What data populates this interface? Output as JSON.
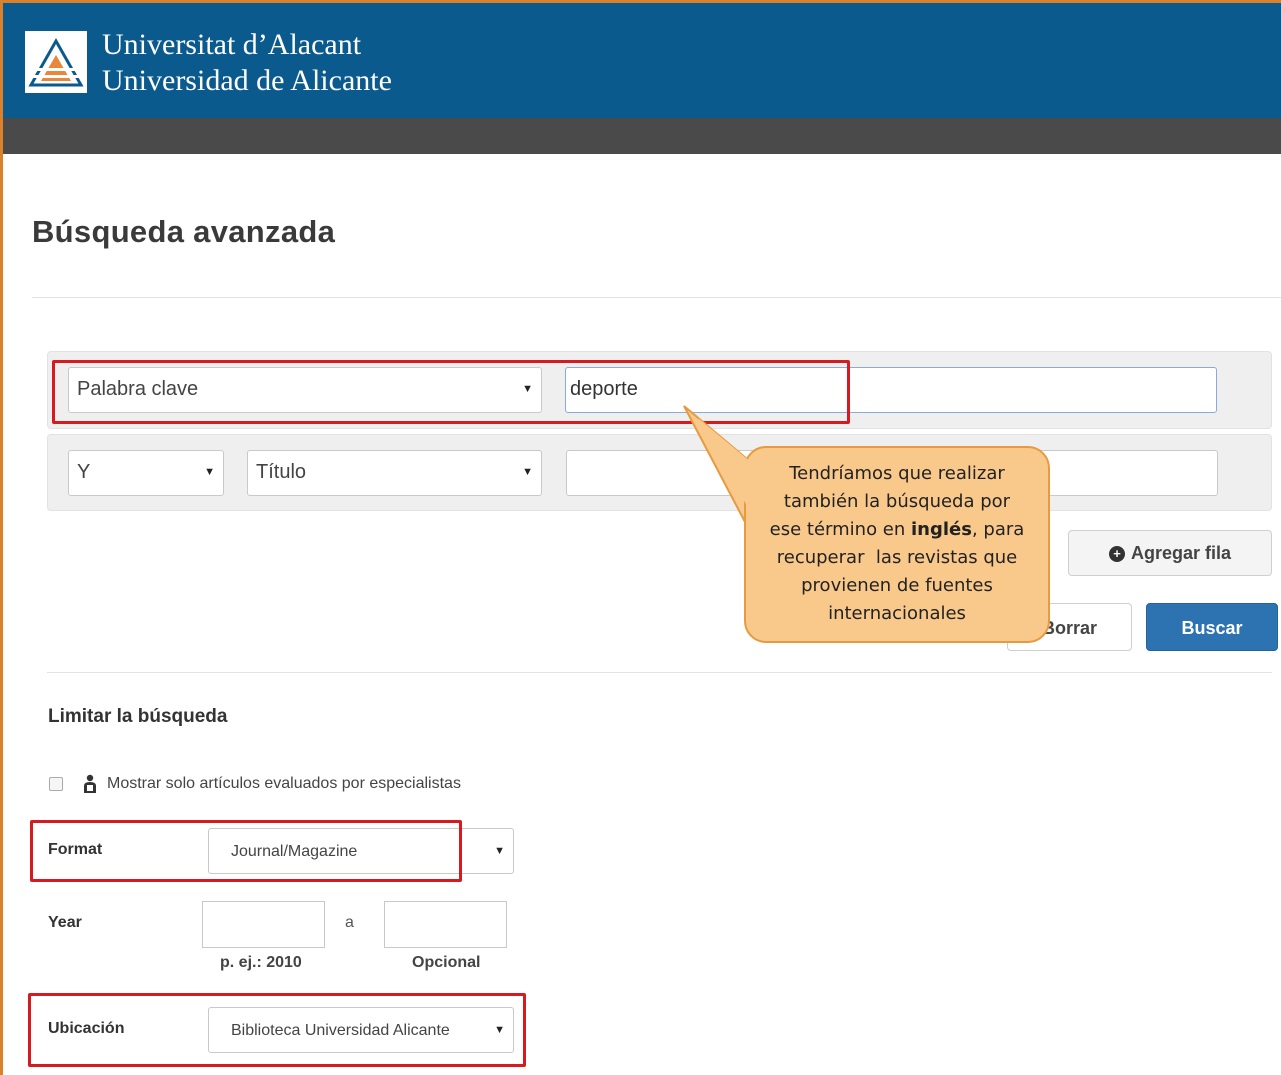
{
  "header": {
    "name_line1": "Universitat d’Alacant",
    "name_line2": "Universidad de Alicante"
  },
  "page": {
    "title": "Búsqueda avanzada"
  },
  "search": {
    "row1": {
      "field": "Palabra clave",
      "value": "deporte"
    },
    "row2": {
      "operator": "Y",
      "field": "Título",
      "value": ""
    },
    "add_row_label": "Agregar fila",
    "clear_label": "Borrar",
    "search_label": "Buscar"
  },
  "callout": {
    "line1": "Tendríamos que realizar",
    "line2": "también la búsqueda por",
    "line3_pre": "ese término en ",
    "line3_bold": "inglés",
    "line3_post": ", para",
    "line4": "recuperar  las revistas que",
    "line5": "provienen de fuentes",
    "line6": "internacionales"
  },
  "limits": {
    "title": "Limitar la búsqueda",
    "peer_review_label": "Mostrar solo artículos evaluados por especialistas",
    "format_label": "Format",
    "format_value": "Journal/Magazine",
    "year_label": "Year",
    "year_separator": "a",
    "year_from_hint": "p. ej.: 2010",
    "year_to_hint": "Opcional",
    "location_label": "Ubicación",
    "location_value": "Biblioteca Universidad Alicante"
  },
  "colors": {
    "header_bg": "#0a5a8e",
    "subbar_bg": "#4a4a4a",
    "highlight": "#d71920",
    "primary_button": "#2d73b2",
    "callout_fill": "#f9c98c"
  }
}
